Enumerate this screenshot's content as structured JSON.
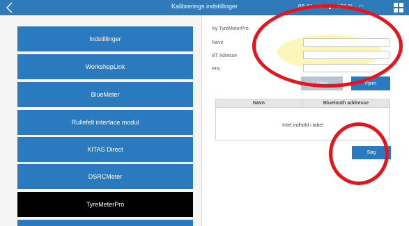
{
  "header": {
    "title": "Kalibrerings indstillinger",
    "time": "09:44",
    "battery": "100 %"
  },
  "sidebar": {
    "items": [
      {
        "label": "Indstillinger"
      },
      {
        "label": "WorkshopLink"
      },
      {
        "label": "BlueMeter"
      },
      {
        "label": "Rullefelt interface modul"
      },
      {
        "label": "KITAS Direct"
      },
      {
        "label": "DSRCMeter"
      },
      {
        "label": "TyreMeterPro"
      }
    ]
  },
  "form": {
    "section_title": "Ny TyreMeterPro",
    "fields": [
      {
        "label": "Navn",
        "value": ""
      },
      {
        "label": "BT Adresse",
        "value": ""
      },
      {
        "label": "PIN",
        "value": ""
      }
    ],
    "add_label": "Tilføj",
    "remove_label": "Fjern"
  },
  "table": {
    "columns": [
      "Navn",
      "Bluetooth addresse"
    ],
    "empty_text": "Intet indhold i tabel"
  },
  "search_label": "Søg",
  "colors": {
    "accent": "#2a7ac0",
    "topbar": "#2f7ab8",
    "active": "#000000",
    "annotation": "#e8141b",
    "highlight": "#fbf5b2"
  }
}
